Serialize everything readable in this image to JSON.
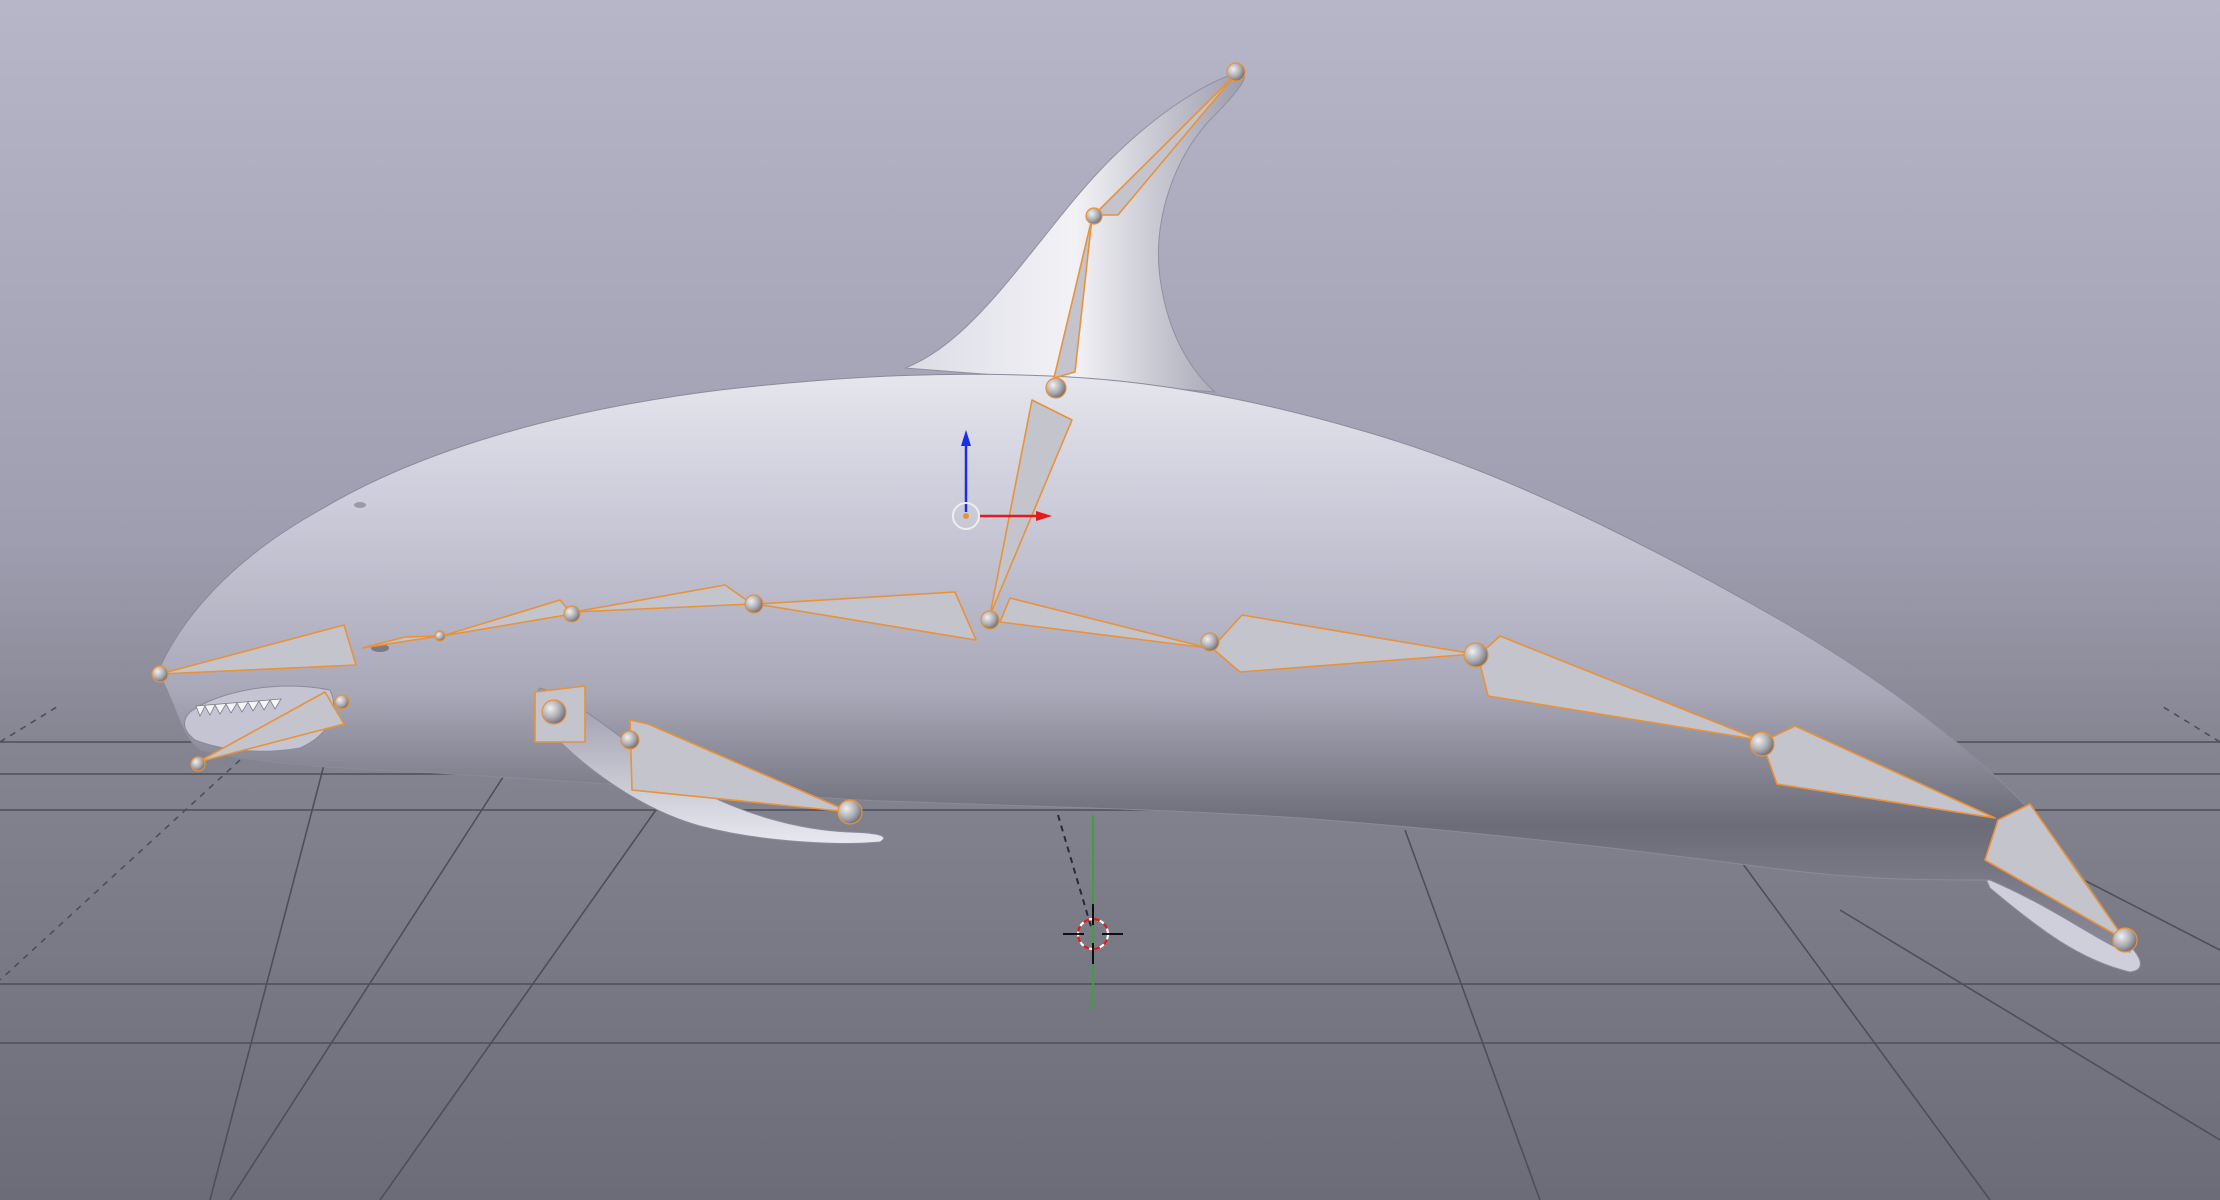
{
  "viewport": {
    "name": "3D Viewport",
    "background_top_color": "#b4b4c6",
    "background_bottom_color": "#6e6e7a",
    "floor_color": "#75757f",
    "grid_color": "#4e4e56",
    "axis_y_color": "#3aa23a"
  },
  "object": {
    "mesh": "orca-mesh",
    "mesh_color": "#c9c9d6",
    "armature": "armature-rig",
    "bone_fill_color": "#c8c8cc",
    "bone_outline_color": "#e8923a",
    "joint_color": "#b8b8bc"
  },
  "gizmos": {
    "origin": "object-origin-icon",
    "z_arrow_color": "#1a2ee6",
    "x_arrow_color": "#e61a1a",
    "cursor": "3d-cursor-icon"
  }
}
